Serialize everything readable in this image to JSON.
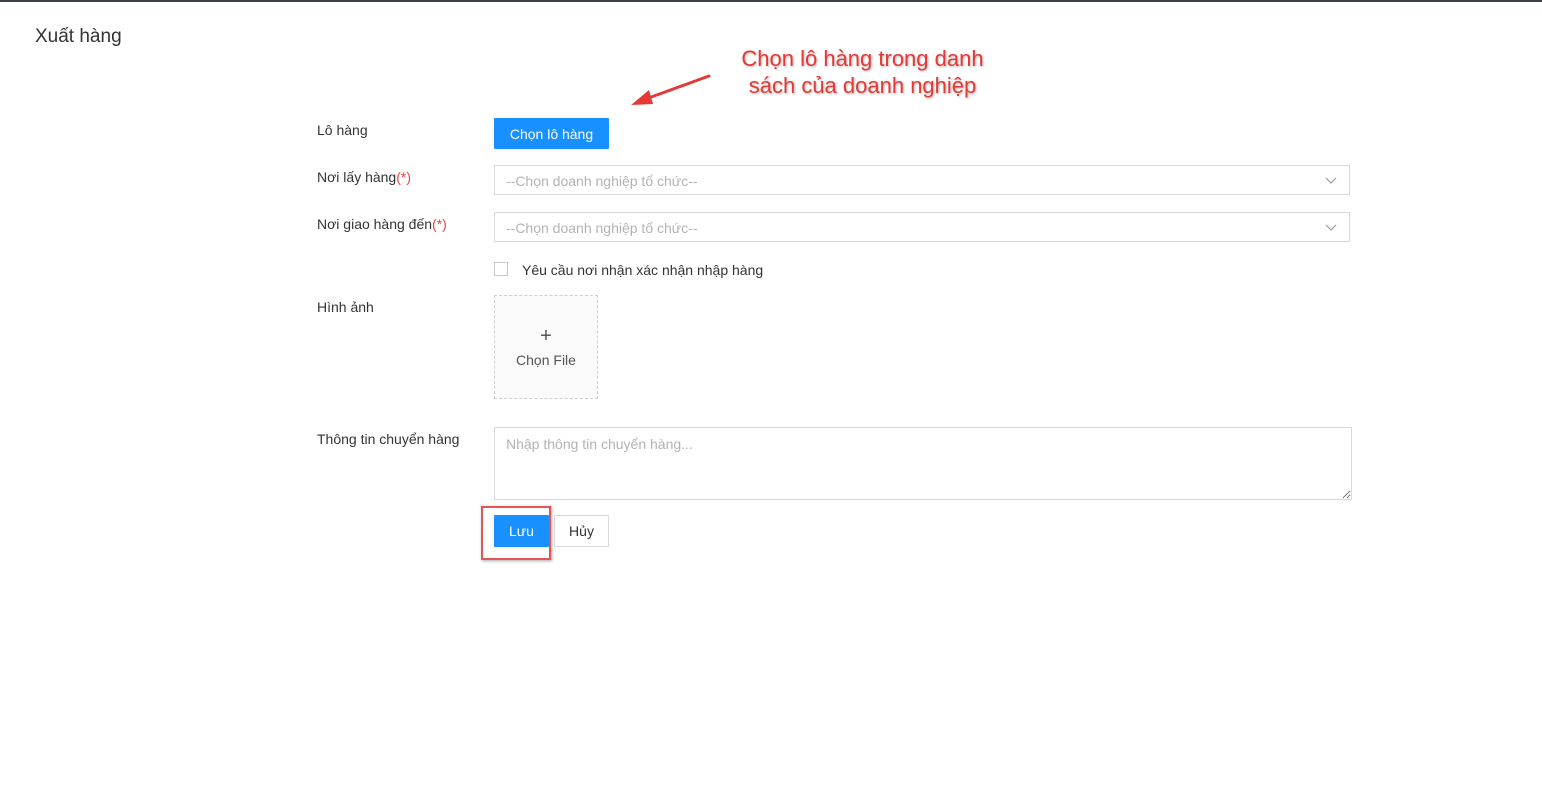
{
  "page": {
    "title": "Xuất hàng"
  },
  "form": {
    "lot": {
      "label": "Lô hàng",
      "button_label": "Chọn lô hàng"
    },
    "pickup": {
      "label": "Nơi lấy hàng",
      "required_mark": "(*)",
      "placeholder": "--Chọn doanh nghiệp tổ chức--"
    },
    "delivery": {
      "label": "Nơi giao hàng đến",
      "required_mark": "(*)",
      "placeholder": "--Chọn doanh nghiệp tổ chức--"
    },
    "confirm": {
      "label": "Yêu cầu nơi nhận xác nhận nhập hàng",
      "checked": false
    },
    "image": {
      "label": "Hình ảnh",
      "plus": "+",
      "upload_label": "Chọn File"
    },
    "shipping_info": {
      "label": "Thông tin chuyển hàng",
      "placeholder": "Nhập thông tin chuyển hàng..."
    },
    "actions": {
      "save_label": "Lưu",
      "cancel_label": "Hủy"
    }
  },
  "annotation": {
    "text": "Chọn lô hàng trong danh sách của doanh nghiệp"
  },
  "colors": {
    "primary": "#1890ff",
    "required": "#e64545",
    "annotation": "#e53935",
    "highlight_border": "#e05555"
  },
  "icons": {
    "select_arrow": "chevron-down-icon",
    "upload": "plus-icon"
  }
}
